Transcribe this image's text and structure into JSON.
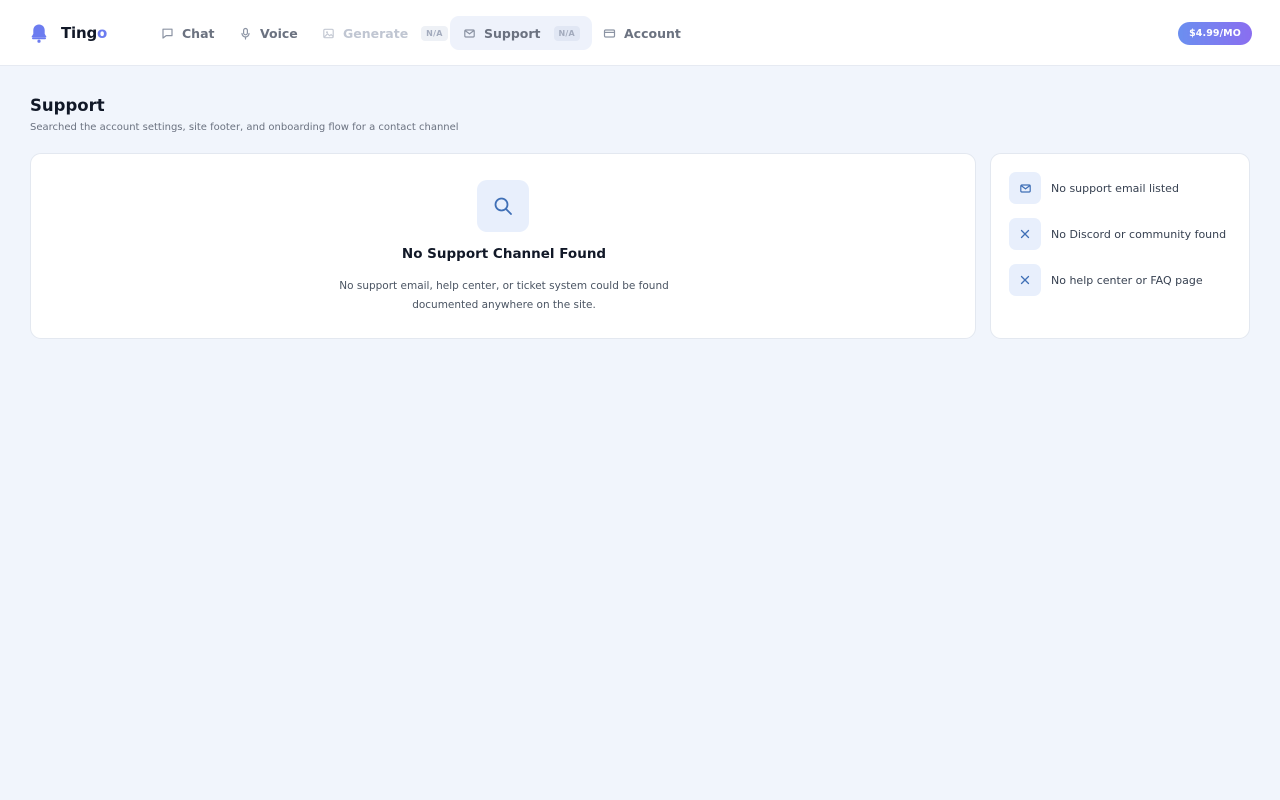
{
  "app": {
    "name_main": "Ting",
    "name_accent": "o",
    "brand_color": "#6c7cf0"
  },
  "nav": {
    "items": [
      {
        "label": "Chat",
        "icon": "chat-bubble-icon"
      },
      {
        "label": "Voice",
        "icon": "microphone-icon"
      },
      {
        "label": "Generate",
        "icon": "image-icon",
        "badge": "N/A",
        "disabled": true
      },
      {
        "label": "Support",
        "icon": "mail-icon",
        "badge": "N/A",
        "active": true
      },
      {
        "label": "Account",
        "icon": "credit-card-icon"
      }
    ]
  },
  "price": {
    "label": "$4.99/MO"
  },
  "page": {
    "title": "Support",
    "subtitle": "Searched the account settings, site footer, and onboarding flow for a contact channel"
  },
  "empty_state": {
    "icon": "search-icon",
    "title": "No Support Channel Found",
    "description": "No support email, help center, or ticket system could be found documented anywhere on the site."
  },
  "checklist": {
    "items": [
      {
        "label": "No support email listed",
        "icon": "mail-icon"
      },
      {
        "label": "No Discord or community found",
        "icon": "close-icon"
      },
      {
        "label": "No help center or FAQ page",
        "icon": "close-icon"
      }
    ]
  },
  "colors": {
    "page_background": "#f1f5fc",
    "icon_blue": "#3f6fb6",
    "price_gradient_start": "#6b8ff0",
    "price_gradient_end": "#8a6ef0"
  }
}
